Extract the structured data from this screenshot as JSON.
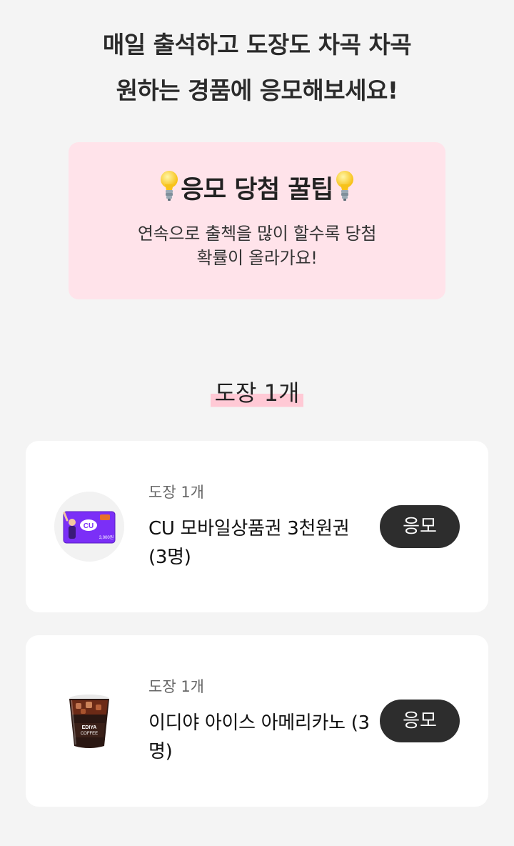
{
  "header": {
    "line1": "매일 출석하고 도장도 차곡 차곡",
    "line2": "원하는 경품에 응모해보세요!"
  },
  "tip": {
    "title": "응모 당첨 꿀팁",
    "icon": "lightbulb-icon",
    "desc_line1": "연속으로 출첵을 많이 할수록 당첨",
    "desc_line2": "확률이 올라가요!"
  },
  "stamps": {
    "label": "도장 1개",
    "highlight_color": "#ffc9d5"
  },
  "prizes": [
    {
      "cost": "도장 1개",
      "name": "CU 모바일상품권 3천원권 (3명)",
      "button": "응모",
      "image": "cu-gift-card-image",
      "card_text": "CU",
      "card_value": "3,000원"
    },
    {
      "cost": "도장 1개",
      "name": "이디야 아이스 아메리카노 (3명)",
      "button": "응모",
      "image": "iced-americano-image",
      "cup_text_1": "EDIYA",
      "cup_text_2": "COFFEE"
    }
  ],
  "colors": {
    "background": "#f4f4f4",
    "tip_background": "#ffe3ea",
    "button": "#2d2d2d",
    "cu_purple": "#7b2ff7"
  }
}
